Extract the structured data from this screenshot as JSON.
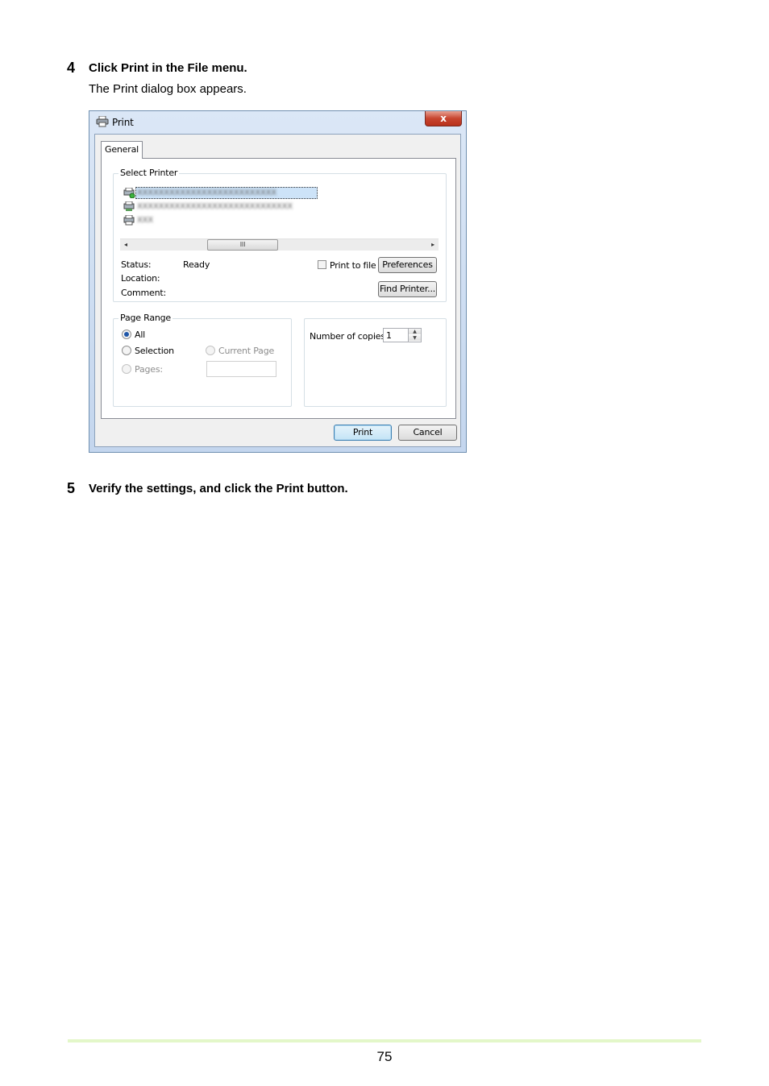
{
  "steps": [
    {
      "number": "4",
      "title": "Click Print in the File menu.",
      "description": "The Print dialog box appears."
    },
    {
      "number": "5",
      "title": "Verify the settings, and click the Print button."
    }
  ],
  "dialog": {
    "title": "Print",
    "close_label": "x",
    "tab": "General",
    "select_printer": {
      "label": "Select Printer",
      "printers": [
        {
          "name": "XXXXXXXXXXXXXXXXXXXXXXXXXX",
          "selected": true
        },
        {
          "name": "XXXXXXXXXXXXXXXXXXXXXXXXXXXXX",
          "selected": false
        },
        {
          "name": "XXX",
          "selected": false
        }
      ],
      "scroll_left": "◂",
      "scroll_thumb": "III",
      "scroll_right": "▸",
      "status_label": "Status:",
      "status_value": "Ready",
      "location_label": "Location:",
      "comment_label": "Comment:",
      "print_to_file": "Print to file",
      "preferences_button": "Preferences",
      "find_printer_button": "Find Printer..."
    },
    "page_range": {
      "label": "Page Range",
      "all": "All",
      "selection": "Selection",
      "current_page": "Current Page",
      "pages": "Pages:"
    },
    "copies": {
      "label": "Number of copies:",
      "value": "1",
      "spin_up": "▲",
      "spin_down": "▼"
    },
    "print_button": "Print",
    "cancel_button": "Cancel"
  },
  "page_number": "75"
}
